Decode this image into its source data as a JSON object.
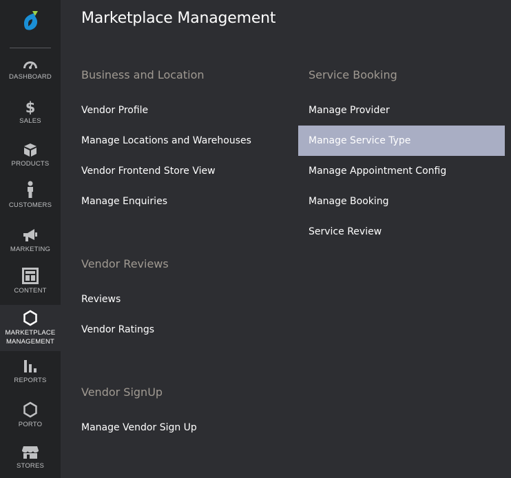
{
  "sidebar": {
    "brand_color": "#1a8fd6",
    "items": [
      {
        "label": "DASHBOARD",
        "icon": "dashboard-icon"
      },
      {
        "label": "SALES",
        "icon": "dollar-icon"
      },
      {
        "label": "PRODUCTS",
        "icon": "box-icon"
      },
      {
        "label": "CUSTOMERS",
        "icon": "person-icon"
      },
      {
        "label": "MARKETING",
        "icon": "megaphone-icon"
      },
      {
        "label": "CONTENT",
        "icon": "layout-icon"
      },
      {
        "label_line1": "MARKETPLACE",
        "label_line2": "MANAGEMENT",
        "icon": "hexagon-icon",
        "active": true
      },
      {
        "label": "REPORTS",
        "icon": "bar-chart-icon"
      },
      {
        "label": "PORTO",
        "icon": "hexagon-icon"
      },
      {
        "label": "STORES",
        "icon": "storefront-icon"
      }
    ]
  },
  "panel": {
    "title": "Marketplace Management",
    "columns": [
      {
        "sections": [
          {
            "title": "Business and Location",
            "links": [
              "Vendor Profile",
              "Manage Locations and Warehouses",
              "Vendor Frontend Store View",
              "Manage Enquiries"
            ]
          },
          {
            "title": "Vendor Reviews",
            "links": [
              "Reviews",
              "Vendor Ratings"
            ]
          },
          {
            "title": "Vendor SignUp",
            "links": [
              "Manage Vendor Sign Up"
            ]
          }
        ]
      },
      {
        "sections": [
          {
            "title": "Service Booking",
            "links": [
              "Manage Provider",
              "Manage Service Type",
              "Manage Appointment Config",
              "Manage Booking",
              "Service Review"
            ],
            "highlighted": "Manage Service Type"
          }
        ]
      }
    ],
    "highlight_color": "#a9aec4"
  }
}
